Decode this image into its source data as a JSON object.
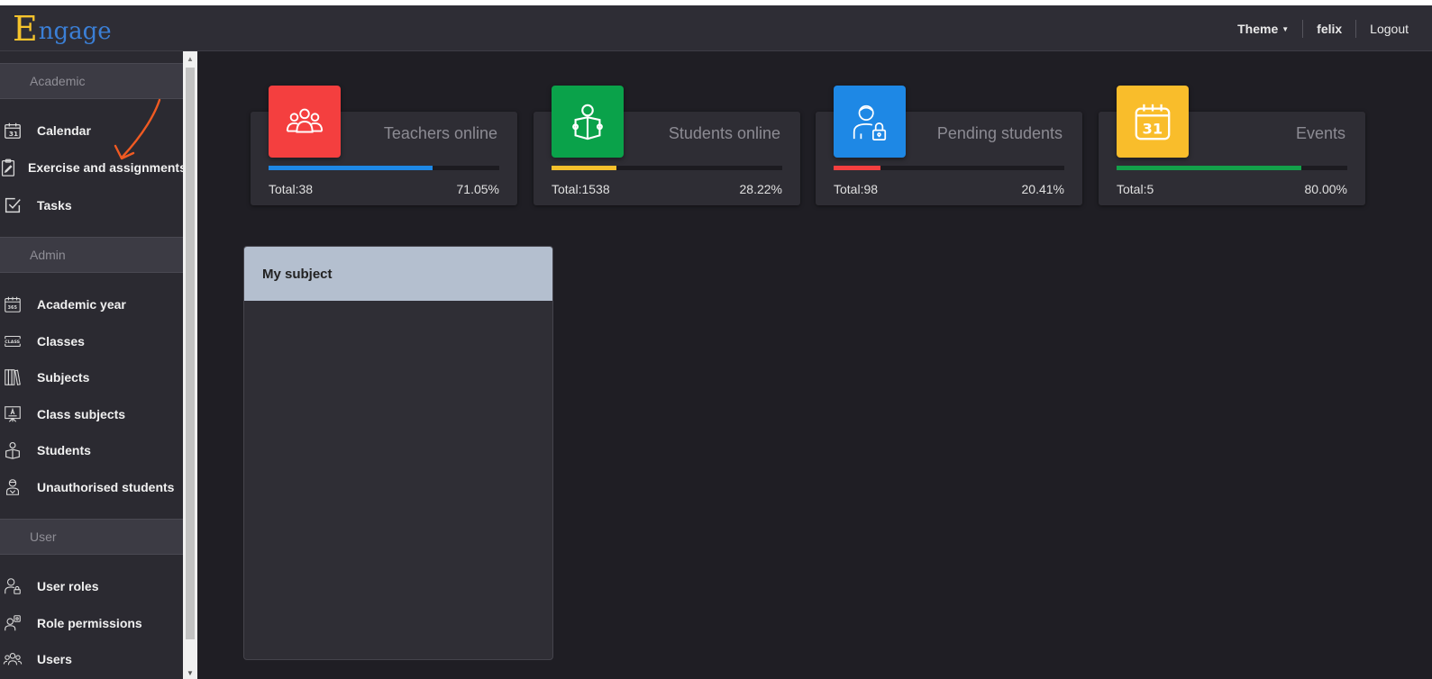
{
  "app": {
    "logo_initial": "E",
    "logo_rest": "ngage"
  },
  "header": {
    "theme_label": "Theme",
    "username": "felix",
    "logout_label": "Logout"
  },
  "sidebar": {
    "sections": [
      {
        "title": "Academic",
        "items": [
          {
            "label": "Calendar",
            "icon": "calendar-icon"
          },
          {
            "label": "Exercise and assignments",
            "icon": "clipboard-icon"
          },
          {
            "label": "Tasks",
            "icon": "checkbox-icon"
          }
        ]
      },
      {
        "title": "Admin",
        "items": [
          {
            "label": "Academic year",
            "icon": "calendar-365-icon"
          },
          {
            "label": "Classes",
            "icon": "class-icon"
          },
          {
            "label": "Subjects",
            "icon": "books-icon"
          },
          {
            "label": "Class subjects",
            "icon": "whiteboard-icon"
          },
          {
            "label": "Students",
            "icon": "student-icon"
          },
          {
            "label": "Unauthorised students",
            "icon": "unauthorised-student-icon"
          }
        ]
      },
      {
        "title": "User",
        "items": [
          {
            "label": "User roles",
            "icon": "user-role-icon"
          },
          {
            "label": "Role permissions",
            "icon": "role-permissions-icon"
          },
          {
            "label": "Users",
            "icon": "users-icon"
          }
        ]
      }
    ]
  },
  "stats": [
    {
      "title": "Teachers online",
      "total": "Total:38",
      "percent": "71.05%",
      "fill": 0.7105,
      "color": "#f43f3f",
      "bar_color": "#1e88e5",
      "icon": "group-icon"
    },
    {
      "title": "Students online",
      "total": "Total:1538",
      "percent": "28.22%",
      "fill": 0.2822,
      "color": "#0aa24a",
      "bar_color": "#f5c02c",
      "icon": "reading-student-icon"
    },
    {
      "title": "Pending students",
      "total": "Total:98",
      "percent": "20.41%",
      "fill": 0.2041,
      "color": "#1e88e5",
      "bar_color": "#f43f3f",
      "icon": "locked-user-icon"
    },
    {
      "title": "Events",
      "total": "Total:5",
      "percent": "80.00%",
      "fill": 0.8,
      "color": "#f9bd2b",
      "bar_color": "#13a04a",
      "icon": "calendar-31-icon"
    }
  ],
  "subject_panel": {
    "title": "My subject"
  }
}
